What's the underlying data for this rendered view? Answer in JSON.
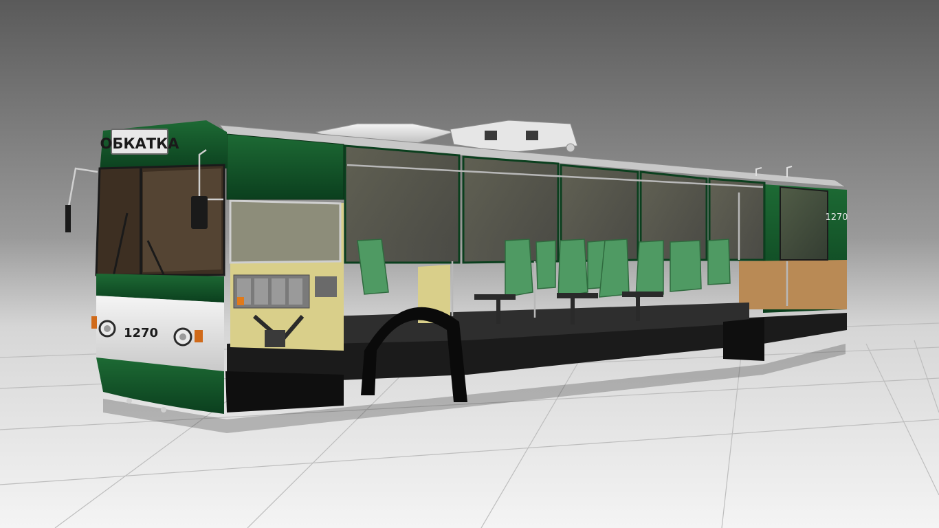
{
  "scene": {
    "route_sign": "ОБКАТКА",
    "front_number": "1270",
    "side_number": "1270",
    "colors": {
      "body_green": "#0e4a24",
      "body_green_light": "#1f6b36",
      "body_white": "#e8e8e8",
      "interior_yellow": "#d9cf8a",
      "seat_green": "#4f9a63",
      "floor_dark": "#2a2a2a",
      "wood_panel": "#b98a55",
      "background_top": "#5e5e5e",
      "background_mid": "#bdbdbd",
      "floor_light": "#f2f2f2"
    }
  }
}
